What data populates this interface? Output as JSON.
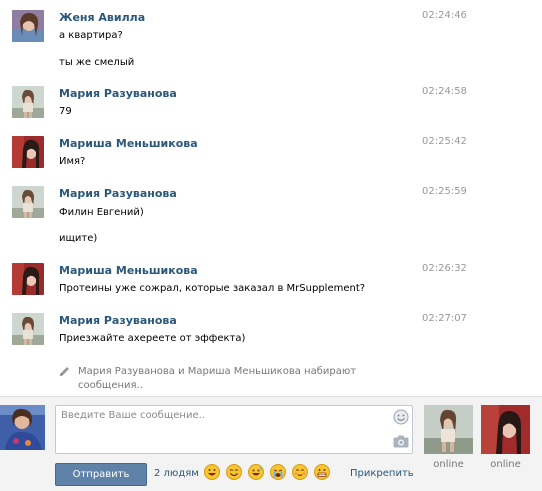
{
  "messages": [
    {
      "author": "Женя Авилла",
      "time": "02:24:46",
      "lines": [
        "а квартира?",
        "ты же смелый"
      ]
    },
    {
      "author": "Мария Разуванова",
      "time": "02:24:58",
      "lines": [
        "79"
      ]
    },
    {
      "author": "Мариша Меньшикова",
      "time": "02:25:42",
      "lines": [
        "Имя?"
      ]
    },
    {
      "author": "Мария Разуванова",
      "time": "02:25:59",
      "lines": [
        "Филин Евгений)",
        "ищите)"
      ]
    },
    {
      "author": "Мариша Меньшикова",
      "time": "02:26:32",
      "lines": [
        "Протеины уже сожрал, которые заказал в MrSupplement?"
      ]
    },
    {
      "author": "Мария Разуванова",
      "time": "02:27:07",
      "lines": [
        "Приезжайте ахереете от эффекта)"
      ]
    }
  ],
  "typing": {
    "line1": "Мария Разуванова и Мариша Меньшикова набирают",
    "line2": "сообщения.."
  },
  "composer": {
    "placeholder": "Введите Ваше сообщение..",
    "send_label": "Отправить",
    "recipients_label": "2 людям",
    "attach_label": "Прикрепить",
    "emoji": [
      "grinning",
      "smiling",
      "sweat-smile",
      "crying",
      "blushing",
      "grimacing"
    ]
  },
  "peers": [
    {
      "status": "online"
    },
    {
      "status": "online"
    }
  ],
  "colors": {
    "link": "#2b587a",
    "time": "#999999",
    "send_button": "#5e82a8",
    "composer_bg": "#f3f3f3"
  },
  "icons": {
    "typing": "pencil-icon",
    "smile": "smile-icon",
    "camera": "camera-icon"
  }
}
